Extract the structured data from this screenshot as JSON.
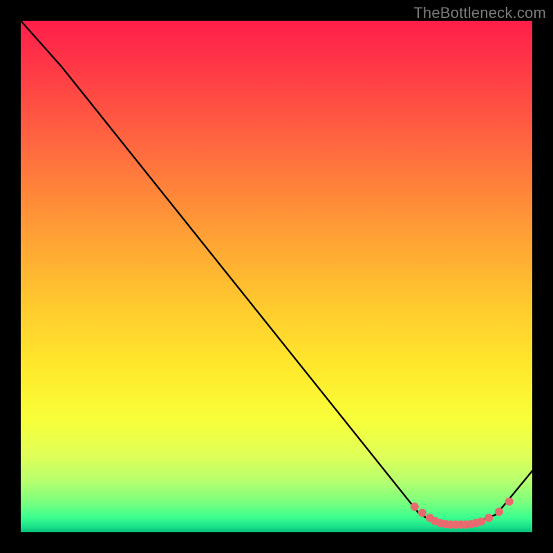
{
  "attribution": "TheBottleneck.com",
  "chart_data": {
    "type": "line",
    "title": "",
    "xlabel": "",
    "ylabel": "",
    "xlim": [
      0,
      100
    ],
    "ylim": [
      0,
      100
    ],
    "x": [
      0,
      8,
      78,
      82,
      88,
      93,
      100
    ],
    "values": [
      100,
      91,
      3.5,
      1.5,
      1.5,
      3.5,
      12
    ],
    "series": [
      {
        "name": "bottleneck-curve",
        "x": [
          0,
          8,
          78,
          82,
          88,
          93,
          100
        ],
        "values": [
          100,
          91,
          3.5,
          1.5,
          1.5,
          3.5,
          12
        ]
      }
    ],
    "markers": {
      "style": "dot",
      "color": "#e86a6f",
      "points": [
        {
          "x": 77,
          "y": 5.0
        },
        {
          "x": 78.5,
          "y": 3.8
        },
        {
          "x": 80,
          "y": 2.8
        },
        {
          "x": 81,
          "y": 2.2
        },
        {
          "x": 82,
          "y": 1.8
        },
        {
          "x": 83,
          "y": 1.6
        },
        {
          "x": 84,
          "y": 1.5
        },
        {
          "x": 85,
          "y": 1.5
        },
        {
          "x": 86,
          "y": 1.5
        },
        {
          "x": 87,
          "y": 1.5
        },
        {
          "x": 88,
          "y": 1.6
        },
        {
          "x": 89,
          "y": 1.8
        },
        {
          "x": 90,
          "y": 2.1
        },
        {
          "x": 91.5,
          "y": 2.8
        },
        {
          "x": 93.5,
          "y": 4.0
        },
        {
          "x": 95.5,
          "y": 6.0
        }
      ]
    }
  }
}
